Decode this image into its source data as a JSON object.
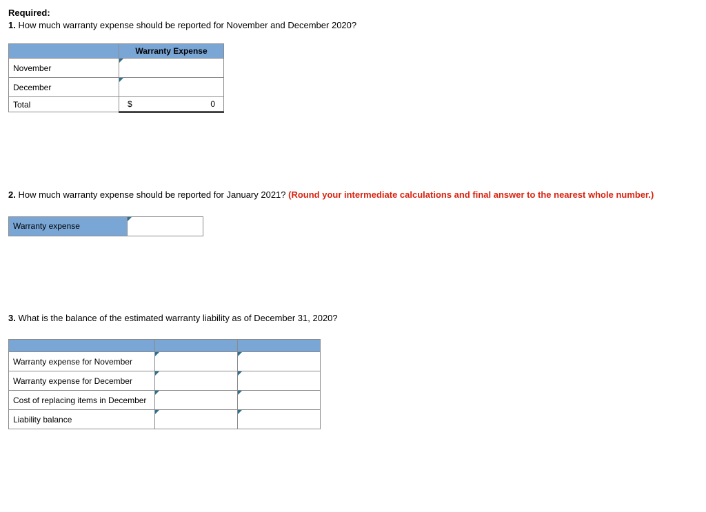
{
  "header": {
    "required": "Required:",
    "q1_num": "1.",
    "q1_text": " How much warranty expense should be reported for November and December 2020?"
  },
  "table1": {
    "col_header": "Warranty Expense",
    "rows": [
      {
        "label": "November"
      },
      {
        "label": "December"
      }
    ],
    "total_label": "Total",
    "currency": "$",
    "total_value": "0"
  },
  "q2": {
    "num": "2.",
    "text_a": " How much warranty expense should be reported for January 2021? ",
    "hint": "(Round your intermediate calculations and final answer to the nearest whole number.)",
    "row_label": "Warranty expense"
  },
  "q3": {
    "num": "3.",
    "text": " What is the balance of the estimated warranty liability as of December 31, 2020?",
    "rows": [
      "Warranty expense for November",
      "Warranty expense for December",
      "Cost of replacing items in December",
      "Liability balance"
    ]
  }
}
